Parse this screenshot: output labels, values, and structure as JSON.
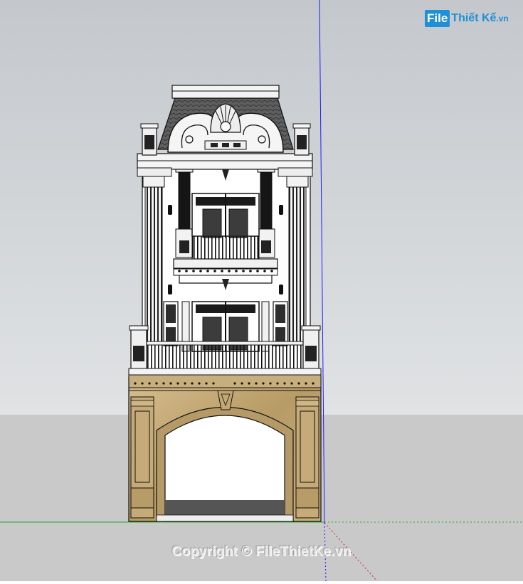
{
  "app": {
    "name": "SketchUp model view"
  },
  "watermark": {
    "logo_box": "File",
    "logo_rest": "Thiết Kế",
    "logo_tld": ".vn",
    "copyright": "Copyright © FileThietKe.vn"
  },
  "scene": {
    "sky_color": "#d2d5d8",
    "ground_color": "#c9c9c9",
    "axis_blue": "#1c1cff",
    "axis_green": "#2fa52f",
    "axis_red": "#d42020",
    "building_wall": "#ffffff",
    "roof_color": "#5b5b5b",
    "stone_color": "#c4a874",
    "ink": "#111111"
  }
}
